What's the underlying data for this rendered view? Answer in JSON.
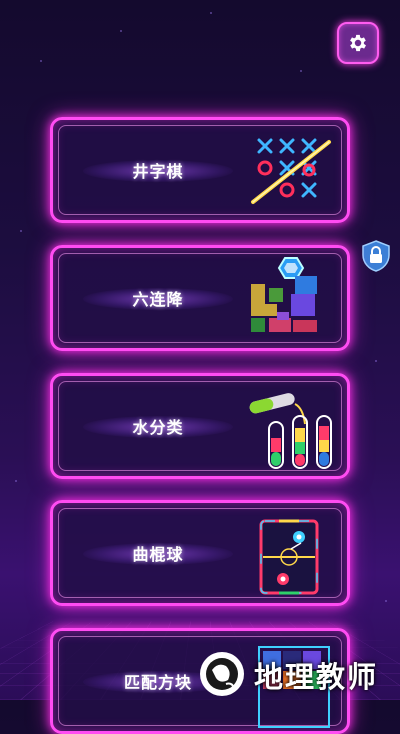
{
  "settings": {
    "icon": "gear-icon"
  },
  "lock_badge": {
    "icon": "lock-icon"
  },
  "games": [
    {
      "label": "井字棋",
      "art": "tic-tac-toe-art"
    },
    {
      "label": "六连降",
      "art": "block-stack-art"
    },
    {
      "label": "水分类",
      "art": "water-sort-art"
    },
    {
      "label": "曲棍球",
      "art": "air-hockey-art"
    },
    {
      "label": "匹配方块",
      "art": "match-blocks-art"
    }
  ],
  "watermark": {
    "text": "地理教师",
    "icon": "globe-logo"
  },
  "colors": {
    "neon_pink": "#ff4cf2",
    "background": "#1c0d3f",
    "cyan": "#3fd0ff"
  }
}
